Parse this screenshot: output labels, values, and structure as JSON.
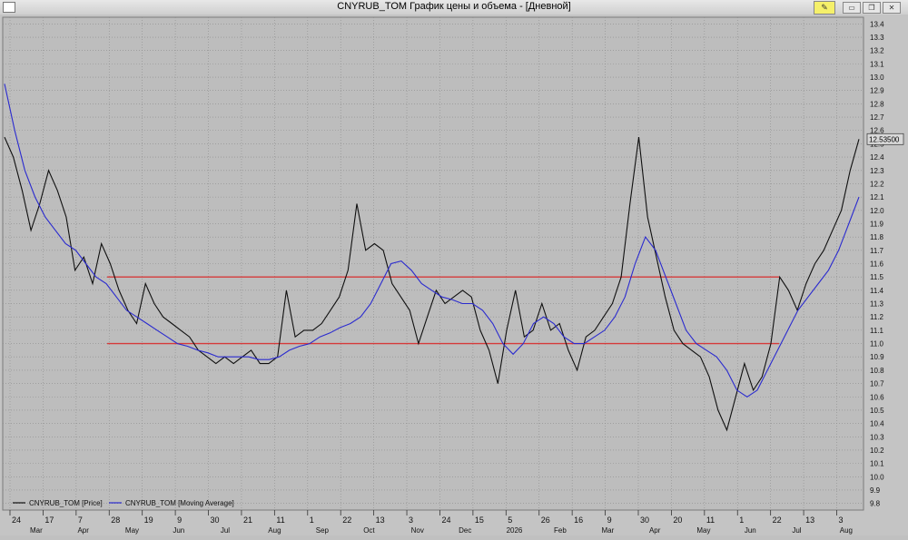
{
  "window": {
    "title": "CNYRUB_TOM График цены и объема - [Дневной]",
    "pin_icon": "pin-icon",
    "buttons": [
      "minimize-icon",
      "restore-icon",
      "close-icon"
    ]
  },
  "colors": {
    "plot_bg": "#bdbdbd",
    "price": "#101010",
    "moving_average": "#2a2acf",
    "levels": "#d63a3a",
    "grid": "#8c8c8c"
  },
  "chart_data": {
    "type": "line",
    "title": "",
    "ylabel": "",
    "xlabel": "",
    "ylim": [
      9.75,
      13.45
    ],
    "yticks": [
      9.8,
      9.9,
      10.0,
      10.1,
      10.2,
      10.3,
      10.4,
      10.5,
      10.6,
      10.7,
      10.8,
      10.9,
      11.0,
      11.1,
      11.2,
      11.3,
      11.4,
      11.5,
      11.6,
      11.7,
      11.8,
      11.9,
      12.0,
      12.1,
      12.2,
      12.3,
      12.4,
      12.5,
      12.6,
      12.7,
      12.8,
      12.9,
      13.0,
      13.1,
      13.2,
      13.3,
      13.4
    ],
    "last_price_label": "12.53500",
    "last_price": 12.535,
    "horizontal_levels": [
      11.5,
      11.0
    ],
    "grid": true,
    "legend_position": "bottom-left",
    "day_ticks": [
      "24",
      "17",
      "7",
      "28",
      "19",
      "9",
      "30",
      "21",
      "11",
      "1",
      "22",
      "13",
      "3",
      "24",
      "15",
      "5",
      "26",
      "16",
      "9",
      "30",
      "20",
      "11",
      "1",
      "22",
      "13",
      "3"
    ],
    "month_ticks": [
      "Mar",
      "Apr",
      "May",
      "Jun",
      "Jul",
      "Aug",
      "Sep",
      "Oct",
      "Nov",
      "Dec",
      "2026",
      "Feb",
      "Mar",
      "Apr",
      "May",
      "Jun",
      "Jul",
      "Aug"
    ],
    "series": [
      {
        "name": "CNYRUB_TOM [Price]",
        "values": [
          12.55,
          12.4,
          12.15,
          11.85,
          12.05,
          12.3,
          12.15,
          11.95,
          11.55,
          11.65,
          11.45,
          11.75,
          11.6,
          11.4,
          11.25,
          11.15,
          11.45,
          11.3,
          11.2,
          11.15,
          11.1,
          11.05,
          10.95,
          10.9,
          10.85,
          10.9,
          10.85,
          10.9,
          10.95,
          10.85,
          10.85,
          10.9,
          11.4,
          11.05,
          11.1,
          11.1,
          11.15,
          11.25,
          11.35,
          11.55,
          12.05,
          11.7,
          11.75,
          11.7,
          11.45,
          11.35,
          11.25,
          11.0,
          11.2,
          11.4,
          11.3,
          11.35,
          11.4,
          11.35,
          11.1,
          10.95,
          10.7,
          11.1,
          11.4,
          11.05,
          11.1,
          11.3,
          11.1,
          11.15,
          10.95,
          10.8,
          11.05,
          11.1,
          11.2,
          11.3,
          11.5,
          12.05,
          12.55,
          11.95,
          11.65,
          11.35,
          11.1,
          11.0,
          10.95,
          10.9,
          10.75,
          10.5,
          10.35,
          10.6,
          10.85,
          10.65,
          10.75,
          11.0,
          11.5,
          11.4,
          11.25,
          11.45,
          11.6,
          11.7,
          11.85,
          12.0,
          12.3,
          12.535
        ]
      },
      {
        "name": "CNYRUB_TOM [Moving Average]",
        "values": [
          12.95,
          12.6,
          12.3,
          12.1,
          11.95,
          11.85,
          11.75,
          11.7,
          11.6,
          11.5,
          11.45,
          11.35,
          11.25,
          11.2,
          11.15,
          11.1,
          11.05,
          11.0,
          10.98,
          10.95,
          10.93,
          10.9,
          10.9,
          10.9,
          10.9,
          10.88,
          10.88,
          10.9,
          10.95,
          10.98,
          11.0,
          11.05,
          11.08,
          11.12,
          11.15,
          11.2,
          11.3,
          11.45,
          11.6,
          11.62,
          11.55,
          11.45,
          11.4,
          11.35,
          11.33,
          11.3,
          11.3,
          11.25,
          11.15,
          11.0,
          10.92,
          11.0,
          11.15,
          11.2,
          11.15,
          11.05,
          11.0,
          11.0,
          11.05,
          11.1,
          11.2,
          11.35,
          11.6,
          11.8,
          11.7,
          11.5,
          11.3,
          11.1,
          11.0,
          10.95,
          10.9,
          10.8,
          10.65,
          10.6,
          10.65,
          10.8,
          10.95,
          11.1,
          11.25,
          11.35,
          11.45,
          11.55,
          11.7,
          11.9,
          12.1
        ]
      }
    ]
  }
}
